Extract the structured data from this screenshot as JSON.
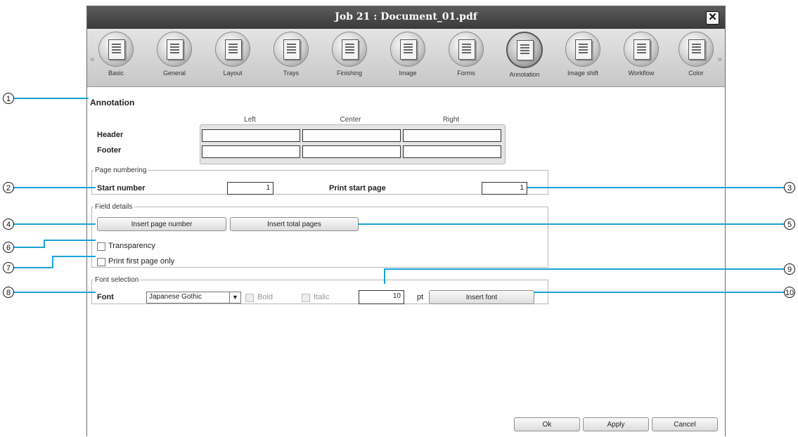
{
  "window": {
    "title": "Job 21 : Document_01.pdf",
    "close_glyph": "✕"
  },
  "toolbar": {
    "left_arrow": "«",
    "right_arrow": "»",
    "items": [
      {
        "label": "Basic",
        "icon": "document-icon"
      },
      {
        "label": "General",
        "icon": "magnifier-icon"
      },
      {
        "label": "Layout",
        "icon": "rotate-layout-icon"
      },
      {
        "label": "Trays",
        "icon": "paper-stack-icon"
      },
      {
        "label": "Finishing",
        "icon": "stapled-doc-icon"
      },
      {
        "label": "Image",
        "icon": "image-icon"
      },
      {
        "label": "Forms",
        "icon": "form-icon"
      },
      {
        "label": "Annotation",
        "icon": "annotation-icon"
      },
      {
        "label": "Image shift",
        "icon": "image-shift-icon"
      },
      {
        "label": "Workflow",
        "icon": "workflow-icon"
      },
      {
        "label": "Color",
        "icon": "color-circles-icon"
      }
    ],
    "selected": "Annotation"
  },
  "annotation": {
    "title": "Annotation",
    "columns": [
      "Left",
      "Center",
      "Right"
    ],
    "header_label": "Header",
    "footer_label": "Footer",
    "header_values": [
      "",
      "",
      ""
    ],
    "footer_values": [
      "",
      "",
      ""
    ]
  },
  "page_numbering": {
    "legend": "Page numbering",
    "start_number_label": "Start number",
    "start_number_value": "1",
    "print_start_page_label": "Print start page",
    "print_start_page_value": "1"
  },
  "field_details": {
    "legend": "Field details",
    "insert_page_number": "Insert page number",
    "insert_total_pages": "Insert total pages",
    "transparency_label": "Transparency",
    "transparency_checked": false,
    "first_page_only_label": "Print first page only",
    "first_page_only_checked": false
  },
  "font_selection": {
    "legend": "Font selection",
    "font_label": "Font",
    "font_value": "Japanese Gothic",
    "bold_label": "Bold",
    "italic_label": "Italic",
    "size_value": "10",
    "size_unit": "pt",
    "insert_font": "Insert font"
  },
  "footer_buttons": {
    "ok": "Ok",
    "apply": "Apply",
    "cancel": "Cancel"
  },
  "callouts": [
    "1",
    "2",
    "3",
    "4",
    "5",
    "6",
    "7",
    "8",
    "9",
    "10"
  ],
  "colors": {
    "callout_line": "#1aa2d8",
    "titlebar": "#474747"
  }
}
